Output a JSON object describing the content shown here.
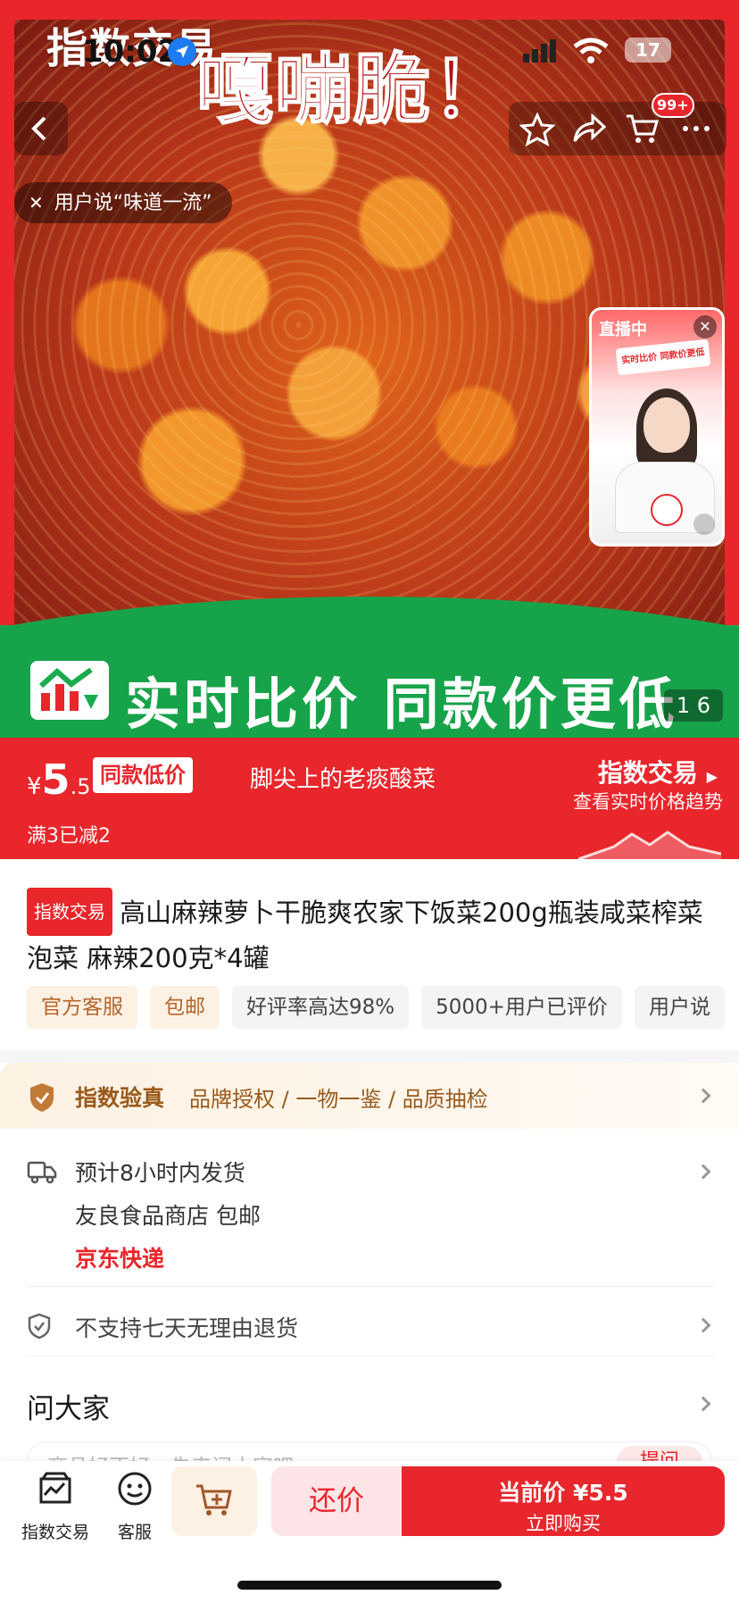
{
  "status_bar": {
    "time": "10:02",
    "battery": "17"
  },
  "hero": {
    "top_text": "嘎嘣脆！",
    "brand_banner": "指数交易",
    "user_quote": "用户说“味道一流”",
    "cart_badge": "99+",
    "green_band_text": "实时比价 同款价更低",
    "page_counter": "1 6",
    "live": {
      "label": "直播中",
      "panel_text": "实时比价 同款价更低"
    }
  },
  "price_bar": {
    "currency": "¥",
    "price_int": "5",
    "price_dec": ".5",
    "low_price_tag": "同款低价",
    "slogan": "脚尖上的老痰酸菜",
    "index_title": "指数交易",
    "index_subtitle": "查看实时价格趋势",
    "promo": "满3已减2"
  },
  "product": {
    "badge": "指数交易",
    "title": "高山麻辣萝卜干脆爽农家下饭菜200g瓶装咸菜榨菜泡菜 麻辣200克*4罐",
    "tags": [
      {
        "label": "官方客服",
        "style": "warm"
      },
      {
        "label": "包邮",
        "style": "warm"
      },
      {
        "label": "好评率高达98%",
        "style": "plain"
      },
      {
        "label": "5000+用户已评价",
        "style": "plain"
      },
      {
        "label": "用户说",
        "style": "plain"
      }
    ]
  },
  "verify": {
    "title": "指数验真",
    "items": "品牌授权 / 一物一鉴 / 品质抽检"
  },
  "shipping": {
    "line1": "预计8小时内发货",
    "line2": "友良食品商店  包邮",
    "carrier": "京东快递"
  },
  "returns": {
    "text": "不支持七天无理由退货"
  },
  "ask": {
    "title": "问大家",
    "placeholder": "商品好不好，先来问大家吧",
    "button": "提问"
  },
  "bottom_bar": {
    "index_label": "指数交易",
    "service_label": "客服",
    "bargain_label": "还价",
    "buy_line1": "当前价 ¥5.5",
    "buy_line2": "立即购买"
  },
  "colors": {
    "brand_red": "#e8262c",
    "green": "#1aab4e",
    "gold": "#9a5a1c"
  }
}
